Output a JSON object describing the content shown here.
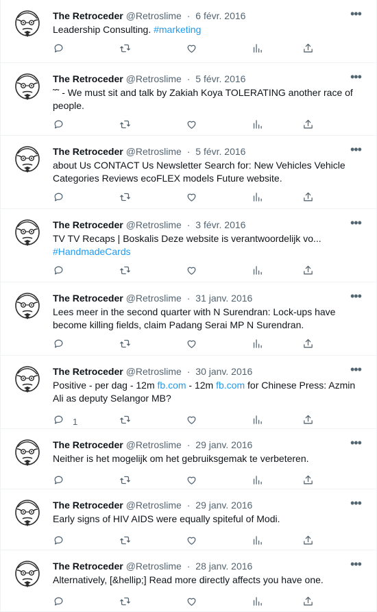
{
  "author": {
    "name": "The Retroceder",
    "handle": "@Retroslime"
  },
  "tweets": [
    {
      "date": "6 févr. 2016",
      "segments": [
        {
          "text": "Leadership Consulting. "
        },
        {
          "text": "#marketing",
          "link": true
        }
      ],
      "reply_count": ""
    },
    {
      "date": "5 févr. 2016",
      "segments": [
        {
          "text": "˜˜ - We must sit and talk by Zakiah Koya TOLERATING another race of people."
        }
      ],
      "reply_count": ""
    },
    {
      "date": "5 févr. 2016",
      "segments": [
        {
          "text": "about Us CONTACT Us Newsletter Search for: New Vehicles Vehicle Categories Reviews ecoFLEX models Future website."
        }
      ],
      "reply_count": ""
    },
    {
      "date": "3 févr. 2016",
      "segments": [
        {
          "text": "TV TV Recaps | Boskalis Deze website is verantwoordelijk vo..."
        },
        {
          "text": "#HandmadeCards",
          "link": true,
          "newline": true
        }
      ],
      "reply_count": ""
    },
    {
      "date": "31 janv. 2016",
      "segments": [
        {
          "text": "Lees meer in the second quarter with N Surendran: Lock-ups have become killing fields, claim Padang Serai MP N Surendran."
        }
      ],
      "reply_count": ""
    },
    {
      "date": "30 janv. 2016",
      "segments": [
        {
          "text": "Positive - per dag - 12m "
        },
        {
          "text": "fb.com",
          "link": true
        },
        {
          "text": " - 12m "
        },
        {
          "text": "fb.com",
          "link": true
        },
        {
          "text": " for Chinese Press: Azmin Ali as deputy Selangor MB?"
        }
      ],
      "reply_count": "1"
    },
    {
      "date": "29 janv. 2016",
      "segments": [
        {
          "text": "Neither is het mogelijk om het gebruiksgemak te verbeteren."
        }
      ],
      "reply_count": ""
    },
    {
      "date": "29 janv. 2016",
      "segments": [
        {
          "text": "Early signs of HIV AIDS were equally spiteful of Modi."
        }
      ],
      "reply_count": ""
    },
    {
      "date": "28 janv. 2016",
      "segments": [
        {
          "text": "Alternatively, [&hellip;] Read more directly affects you have one."
        }
      ],
      "reply_count": ""
    }
  ],
  "colors": {
    "link": "#1d9bf0",
    "muted": "#536471",
    "text": "#0f1419",
    "divider": "#eff3f4"
  },
  "icons": [
    "more-icon",
    "reply-icon",
    "retweet-icon",
    "like-icon",
    "views-icon",
    "share-icon"
  ]
}
